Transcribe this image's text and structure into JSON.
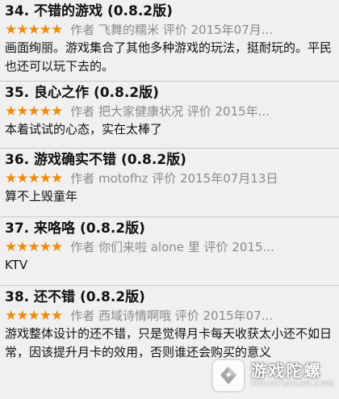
{
  "reviews": [
    {
      "title": "34. 不错的游戏 (0.8.2版)",
      "stars": "★★★★★",
      "meta": "作者 飞舞的糯米 评价 2015年07月...",
      "lines": [
        "画面绚丽。游戏集合了其他多种游戏的玩法，挺耐玩的。平民也还可以玩下去的。"
      ]
    },
    {
      "title": "35. 良心之作 (0.8.2版)",
      "stars": "★★★★★",
      "meta": "作者 把大家健康状况 评价 2015年...",
      "lines": [
        "本着试试的心态，实在太棒了"
      ]
    },
    {
      "title": "36. 游戏确实不错 (0.8.2版)",
      "stars": "★★★★★",
      "meta": "作者 motofhz 评价 2015年07月13日",
      "lines": [
        "算不上毁童年"
      ]
    },
    {
      "title": "37. 来咯咯 (0.8.2版)",
      "stars": "★★★★★",
      "meta": "作者 你们来啦 alone 里 评价 2015...",
      "lines": [
        "KTV"
      ]
    },
    {
      "title": "38. 还不错 (0.8.2版)",
      "stars": "★★★★★",
      "meta": "作者 西域诗情啊哦 评价 2015年07...",
      "lines": [
        "游戏整体设计的还不错，只是觉得月卡每天收获太小还不如日常，因该提升月卡的效用，否则谁还会购买的意义"
      ]
    }
  ],
  "watermark": {
    "name": "游戏陀螺",
    "domain": "YOUXITUOLUO.COM"
  },
  "colors": {
    "star": "#f08a0a",
    "meta": "#8a8a8a",
    "background": "#f0f0f0"
  }
}
